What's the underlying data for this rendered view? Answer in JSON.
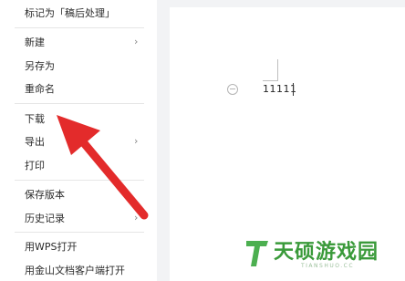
{
  "menu": {
    "items": [
      {
        "label": "标记为「稿后处理」",
        "has_submenu": false
      },
      {
        "label": "新建",
        "has_submenu": true
      },
      {
        "label": "另存为",
        "has_submenu": false
      },
      {
        "label": "重命名",
        "has_submenu": false
      },
      {
        "label": "下载",
        "has_submenu": false
      },
      {
        "label": "导出",
        "has_submenu": true
      },
      {
        "label": "打印",
        "has_submenu": false
      },
      {
        "label": "保存版本",
        "has_submenu": false
      },
      {
        "label": "历史记录",
        "has_submenu": true
      },
      {
        "label": "用WPS打开",
        "has_submenu": false
      },
      {
        "label": "用金山文档客户端打开",
        "has_submenu": false
      }
    ],
    "chevron": "›"
  },
  "document": {
    "text": "11111"
  },
  "annotation": {
    "arrow_color": "#e32b2b"
  },
  "watermark": {
    "brand": "天硕游戏园",
    "domain": "TIANSHUO.CC",
    "color": "#3a9a3a"
  }
}
